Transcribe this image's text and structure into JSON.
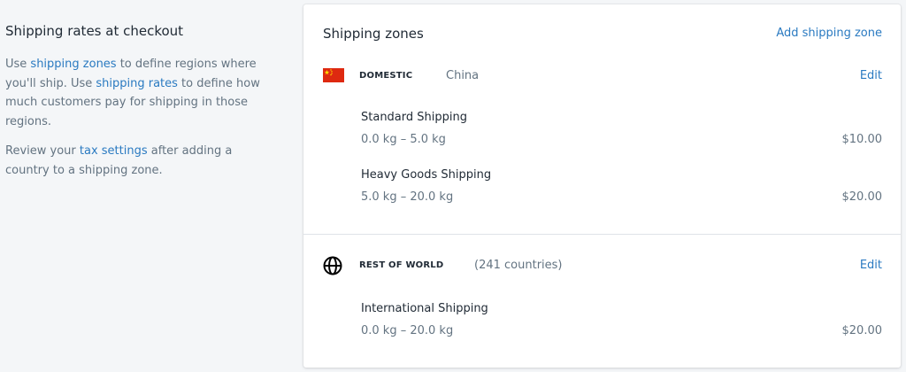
{
  "aside": {
    "title": "Shipping rates at checkout",
    "p1_part1": "Use ",
    "p1_link1": "shipping zones",
    "p1_part2": " to define regions where you'll ship. Use ",
    "p1_link2": "shipping rates",
    "p1_part3": " to define how much customers pay for shipping in those regions.",
    "p2_part1": "Review your ",
    "p2_link": "tax settings",
    "p2_part2": " after adding a country to a shipping zone."
  },
  "card": {
    "title": "Shipping zones",
    "add_zone_label": "Add shipping zone"
  },
  "zones": [
    {
      "icon": "china-flag-icon",
      "tag": "DOMESTIC",
      "subtitle": "China",
      "edit_label": "Edit",
      "rates": [
        {
          "name": "Standard Shipping",
          "range": "0.0 kg – 5.0 kg",
          "price": "$10.00"
        },
        {
          "name": "Heavy Goods Shipping",
          "range": "5.0 kg – 20.0 kg",
          "price": "$20.00"
        }
      ]
    },
    {
      "icon": "globe-icon",
      "tag": "REST OF WORLD",
      "subtitle": "(241 countries)",
      "edit_label": "Edit",
      "rates": [
        {
          "name": "International Shipping",
          "range": "0.0 kg – 20.0 kg",
          "price": "$20.00"
        }
      ]
    }
  ],
  "colors": {
    "link": "#2a7ac1",
    "page_bg": "#f4f6f8",
    "card_bg": "#ffffff",
    "text": "#212b36",
    "subdued": "#637381",
    "flag_red": "#de2910",
    "flag_yellow": "#ffde00"
  }
}
